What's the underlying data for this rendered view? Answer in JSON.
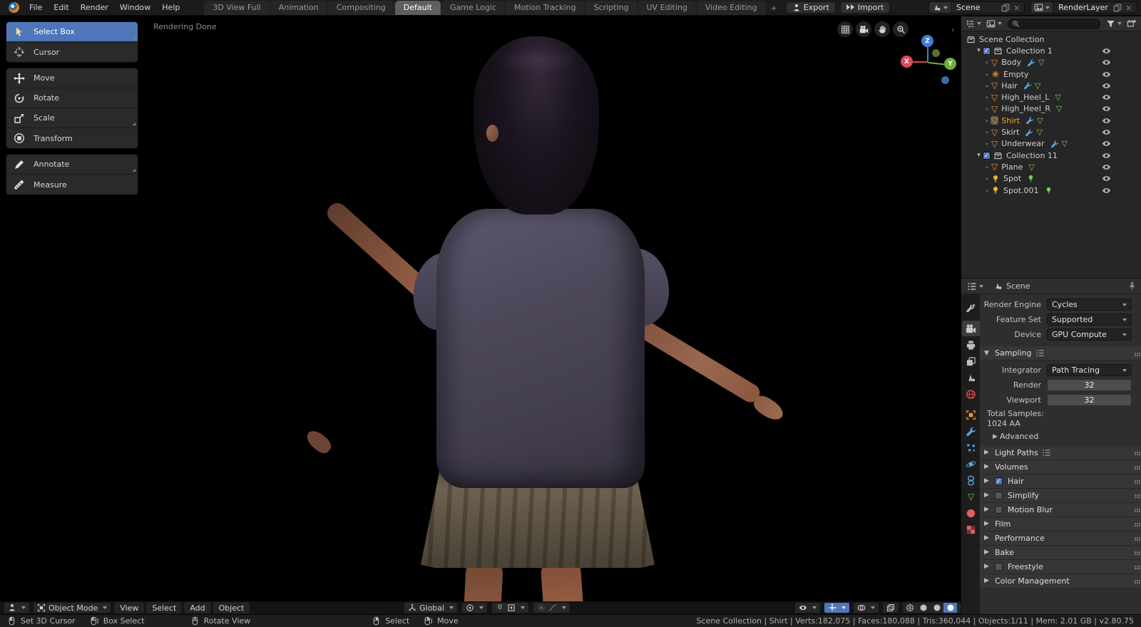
{
  "topbar": {
    "menus": [
      "File",
      "Edit",
      "Render",
      "Window",
      "Help"
    ],
    "tabs": [
      "3D View Full",
      "Animation",
      "Compositing",
      "Default",
      "Game Logic",
      "Motion Tracking",
      "Scripting",
      "UV Editing",
      "Video Editing"
    ],
    "active_tab": "Default",
    "add_tab_label": "+",
    "export_label": "Export",
    "import_label": "Import",
    "scene_field": {
      "value": "Scene"
    },
    "renderlayer_field": {
      "value": "RenderLayer"
    }
  },
  "toolbar": {
    "active": "Select Box",
    "groups": [
      [
        {
          "label": "Select Box",
          "icon": "select",
          "corner": true
        },
        {
          "label": "Cursor",
          "icon": "cursor"
        }
      ],
      [
        {
          "label": "Move",
          "icon": "move"
        },
        {
          "label": "Rotate",
          "icon": "rotate"
        },
        {
          "label": "Scale",
          "icon": "scalei",
          "corner": true
        },
        {
          "label": "Transform",
          "icon": "transform"
        }
      ],
      [
        {
          "label": "Annotate",
          "icon": "pen",
          "corner": true
        },
        {
          "label": "Measure",
          "icon": "ruler"
        }
      ]
    ]
  },
  "viewport": {
    "status_text": "Rendering Done",
    "gizmo_axes": {
      "x": "X",
      "y": "Y",
      "z": "Z"
    }
  },
  "viewport_header": {
    "mode_label": "Object Mode",
    "menus": [
      "View",
      "Select",
      "Add",
      "Object"
    ],
    "orientation_label": "Global"
  },
  "outliner": {
    "items": [
      {
        "label": "Scene Collection",
        "type": "collection",
        "depth": 0
      },
      {
        "label": "Collection 1",
        "type": "collection",
        "depth": 1,
        "checkbox": true,
        "expanded": true,
        "eye": true
      },
      {
        "label": "Body",
        "type": "mesh",
        "depth": 2,
        "extras": [
          "wrench",
          "meshdata"
        ],
        "eye": true
      },
      {
        "label": "Empty",
        "type": "empty",
        "depth": 2,
        "extras": [],
        "eye": true
      },
      {
        "label": "Hair",
        "type": "mesh",
        "depth": 2,
        "extras": [
          "wrench",
          "meshdata"
        ],
        "eye": true
      },
      {
        "label": "High_Heel_L",
        "type": "mesh",
        "depth": 2,
        "extras": [
          "meshdata"
        ],
        "eye": true
      },
      {
        "label": "High_Heel_R",
        "type": "mesh",
        "depth": 2,
        "extras": [
          "meshdata"
        ],
        "eye": true
      },
      {
        "label": "Shirt",
        "type": "mesh",
        "depth": 2,
        "extras": [
          "wrench",
          "meshdata"
        ],
        "eye": true,
        "selected": true
      },
      {
        "label": "Skirt",
        "type": "mesh",
        "depth": 2,
        "extras": [
          "wrench",
          "meshdata"
        ],
        "eye": true
      },
      {
        "label": "Underwear",
        "type": "mesh",
        "depth": 2,
        "extras": [
          "wrench",
          "meshdata"
        ],
        "eye": true
      },
      {
        "label": "Collection 11",
        "type": "collection",
        "depth": 1,
        "checkbox": true,
        "expanded": true,
        "eye": true
      },
      {
        "label": "Plane",
        "type": "mesh",
        "depth": 2,
        "extras": [
          "meshdata"
        ],
        "eye": true
      },
      {
        "label": "Spot",
        "type": "light",
        "depth": 2,
        "extras": [
          "lightdata"
        ],
        "eye": true
      },
      {
        "label": "Spot.001",
        "type": "light",
        "depth": 2,
        "extras": [
          "lightdata"
        ],
        "eye": true
      }
    ]
  },
  "properties": {
    "breadcrumb": "Scene",
    "tabs": [
      {
        "id": "tool"
      },
      {
        "id": "render",
        "active": true
      },
      {
        "id": "output"
      },
      {
        "id": "view-layer"
      },
      {
        "id": "scene"
      },
      {
        "id": "world"
      },
      {
        "id": "object"
      },
      {
        "id": "modifiers"
      },
      {
        "id": "particles"
      },
      {
        "id": "physics"
      },
      {
        "id": "constraints"
      },
      {
        "id": "data"
      },
      {
        "id": "material"
      },
      {
        "id": "texture"
      }
    ],
    "render_fields": [
      {
        "label": "Render Engine",
        "value": "Cycles"
      },
      {
        "label": "Feature Set",
        "value": "Supported"
      },
      {
        "label": "Device",
        "value": "GPU Compute"
      }
    ],
    "sampling": {
      "title": "Sampling",
      "fields": [
        {
          "label": "Integrator",
          "value": "Path Tracing",
          "type": "dropdown"
        },
        {
          "label": "Render",
          "value": "32",
          "type": "number"
        },
        {
          "label": "Viewport",
          "value": "32",
          "type": "number"
        }
      ],
      "total_label": "Total Samples:",
      "total_value": "1024 AA",
      "advanced_label": "Advanced"
    },
    "sections": [
      {
        "label": "Light Paths",
        "list": true
      },
      {
        "label": "Volumes"
      },
      {
        "label": "Hair",
        "checkbox": true,
        "checked": true
      },
      {
        "label": "Simplify",
        "checkbox": true
      },
      {
        "label": "Motion Blur",
        "checkbox": true
      },
      {
        "label": "Film"
      },
      {
        "label": "Performance"
      },
      {
        "label": "Bake"
      },
      {
        "label": "Freestyle",
        "checkbox": true
      },
      {
        "label": "Color Management"
      }
    ]
  },
  "statusbar": {
    "hints": [
      {
        "icon": "mouse-l",
        "label": "Set 3D Cursor"
      },
      {
        "icon": "mouse-ld",
        "label": "Box Select"
      },
      {
        "icon": "mouse-m",
        "label": "Rotate View",
        "gap": 44
      },
      {
        "icon": "mouse-r",
        "label": "Select",
        "gap": 150
      },
      {
        "icon": "mouse-rd",
        "label": "Move"
      }
    ],
    "stats": "Scene Collection | Shirt | Verts:182,075 | Faces:180,088 | Tris:360,044 | Objects:1/11 | Mem: 2.01 GB | v2.80.75"
  },
  "colors": {
    "accent": "#4f76b8",
    "selection_text": "#eda53c",
    "mesh_icon": "#ef9038",
    "data_icon": "#79cf50",
    "modifier_icon": "#58a6dc",
    "light_icon": "#e8b23c"
  }
}
